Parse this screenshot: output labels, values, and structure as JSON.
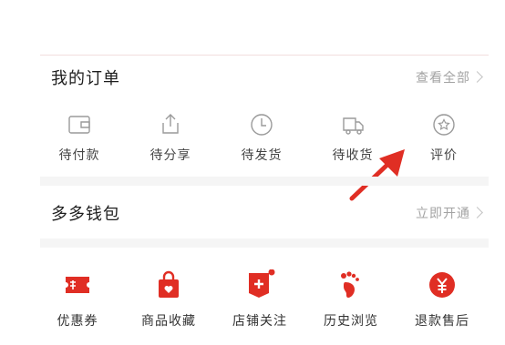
{
  "orders": {
    "title": "我的订单",
    "view_all": "查看全部",
    "items": [
      {
        "label": "待付款",
        "icon": "wallet-icon"
      },
      {
        "label": "待分享",
        "icon": "share-icon"
      },
      {
        "label": "待发货",
        "icon": "clock-icon"
      },
      {
        "label": "待收货",
        "icon": "truck-icon"
      },
      {
        "label": "评价",
        "icon": "review-icon"
      }
    ]
  },
  "wallet": {
    "title": "多多钱包",
    "open_now": "立即开通"
  },
  "tools": {
    "items": [
      {
        "label": "优惠券",
        "icon": "coupon-icon"
      },
      {
        "label": "商品收藏",
        "icon": "favorite-bag-icon"
      },
      {
        "label": "店铺关注",
        "icon": "shop-follow-icon"
      },
      {
        "label": "历史浏览",
        "icon": "footprint-icon"
      },
      {
        "label": "退款售后",
        "icon": "refund-icon"
      }
    ]
  },
  "colors": {
    "accent": "#e02e24",
    "muted": "#a3a3a3",
    "icon_gray": "#9a9a9a"
  }
}
